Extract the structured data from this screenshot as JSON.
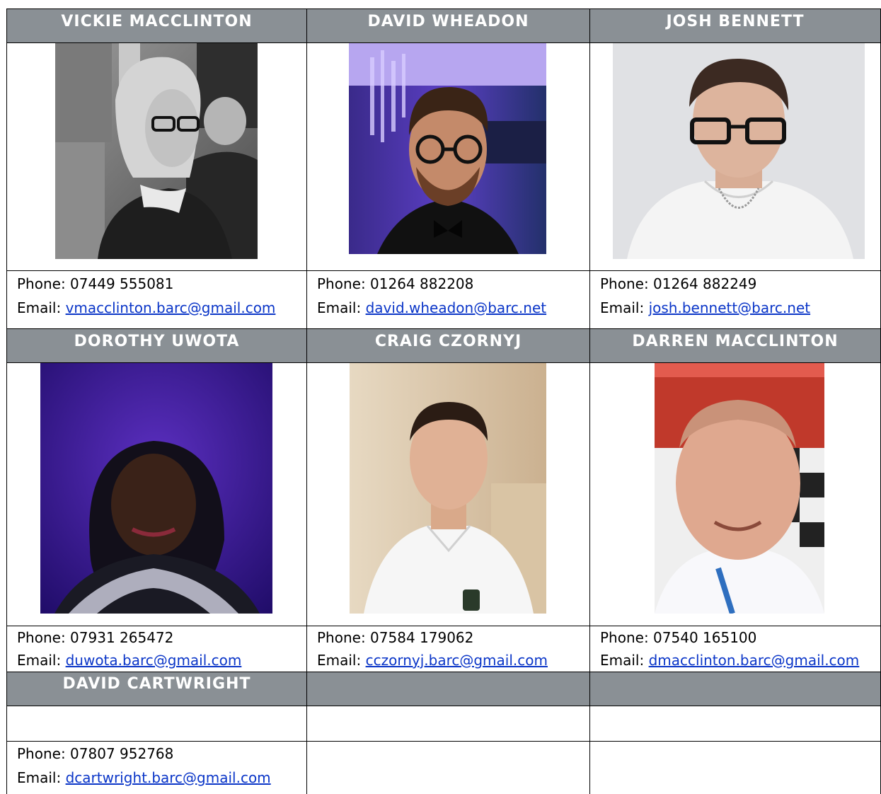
{
  "contacts": [
    {
      "name": "VICKIE MACCLINTON",
      "phone": "Phone: 07449 555081",
      "email_label": "Email: ",
      "email": "vmacclinton.barc@gmail.com"
    },
    {
      "name": "DAVID WHEADON",
      "phone": "Phone: 01264 882208",
      "email_label": "Email: ",
      "email": "david.wheadon@barc.net"
    },
    {
      "name": "JOSH BENNETT",
      "phone": "Phone: 01264 882249",
      "email_label": "Email: ",
      "email": "josh.bennett@barc.net"
    },
    {
      "name": "DOROTHY UWOTA",
      "phone": "Phone: 07931 265472",
      "email_label": "Email: ",
      "email": "duwota.barc@gmail.com"
    },
    {
      "name": "CRAIG CZORNYJ",
      "phone": "Phone: 07584 179062",
      "email_label": "Email: ",
      "email": "cczornyj.barc@gmail.com"
    },
    {
      "name": "DARREN MACCLINTON",
      "phone": "Phone: 07540 165100",
      "email_label": "Email: ",
      "email": "dmacclinton.barc@gmail.com"
    },
    {
      "name": "DAVID CARTWRIGHT",
      "phone": "Phone: 07807 952768",
      "email_label": "Email: ",
      "email": "dcartwright.barc@gmail.com"
    }
  ],
  "colors": {
    "header_bg": "#8a9095",
    "header_text": "#ffffff",
    "link": "#0b36c8"
  }
}
